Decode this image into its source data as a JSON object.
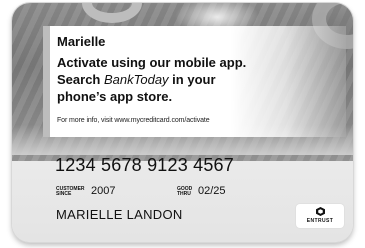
{
  "panel": {
    "name": "Marielle",
    "line1": "Activate using our mobile app.",
    "line2_prefix": "Search ",
    "line2_app": "BankToday",
    "line2_suffix": " in your",
    "line3": "phone’s app store.",
    "info": "For more info, visit www.mycreditcard.com/activate"
  },
  "card": {
    "number": "1234 5678 9123 4567",
    "customer_since_label_top": "CUSTOMER",
    "customer_since_label_bottom": "SINCE",
    "customer_since_value": "2007",
    "good_thru_label_top": "GOOD",
    "good_thru_label_bottom": "THRU",
    "good_thru_value": "02/25",
    "holder_name": "MARIELLE  LANDON"
  },
  "logo": {
    "text": "ENTRUST",
    "icon": "entrust-logo-icon"
  },
  "colors": {
    "text": "#111111",
    "panel_bar": "#bdbdbd",
    "card_background": "#ececec"
  }
}
